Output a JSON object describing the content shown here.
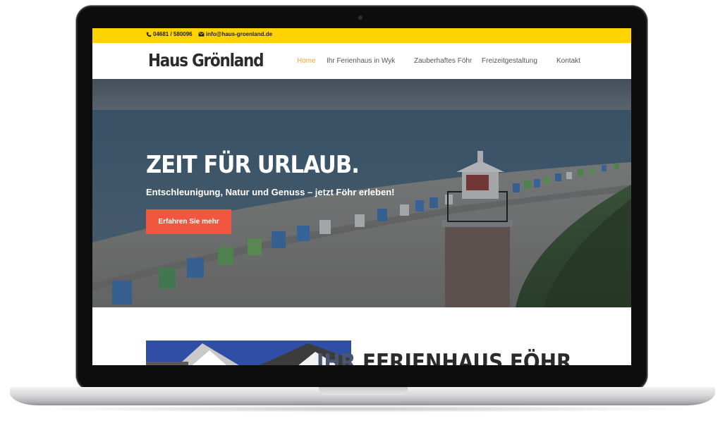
{
  "topbar": {
    "phone": "04681 / 580096",
    "email": "info@haus-groenland.de",
    "phone_icon": "phone-icon",
    "email_icon": "envelope-icon",
    "color": "#ffd300"
  },
  "header": {
    "logo": "Haus Grönland",
    "nav": [
      {
        "label": "Home",
        "active": true
      },
      {
        "label": "Ihr Ferienhaus in Wyk",
        "active": false
      },
      {
        "label": "Zauberhaftes Föhr",
        "active": false
      },
      {
        "label": "Freizeitgestaltung",
        "active": false
      },
      {
        "label": "Kontakt",
        "active": false
      }
    ],
    "active_color": "#f0a53a"
  },
  "hero": {
    "title": "ZEIT FÜR URLAUB.",
    "subtitle": "Entschleunigung, Natur und Genuss – jetzt Föhr erleben!",
    "button_label": "Erfahren Sie mehr",
    "button_color": "#f0573e"
  },
  "section": {
    "heading_prefix": "IHR",
    "heading": "FERIENHAUS FÖHR"
  }
}
